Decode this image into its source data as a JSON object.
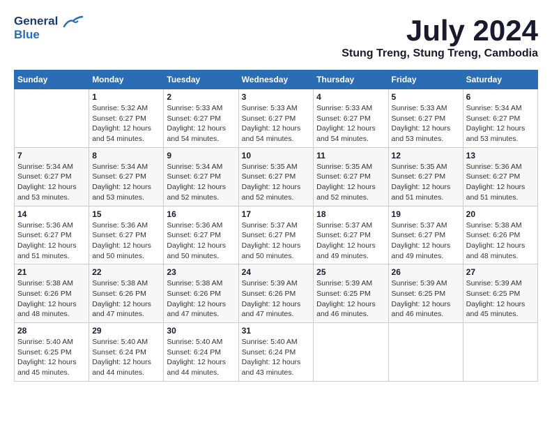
{
  "header": {
    "logo_line1": "General",
    "logo_line2": "Blue",
    "month_year": "July 2024",
    "location": "Stung Treng, Stung Treng, Cambodia"
  },
  "columns": [
    "Sunday",
    "Monday",
    "Tuesday",
    "Wednesday",
    "Thursday",
    "Friday",
    "Saturday"
  ],
  "weeks": [
    [
      {
        "day": "",
        "info": ""
      },
      {
        "day": "1",
        "info": "Sunrise: 5:32 AM\nSunset: 6:27 PM\nDaylight: 12 hours\nand 54 minutes."
      },
      {
        "day": "2",
        "info": "Sunrise: 5:33 AM\nSunset: 6:27 PM\nDaylight: 12 hours\nand 54 minutes."
      },
      {
        "day": "3",
        "info": "Sunrise: 5:33 AM\nSunset: 6:27 PM\nDaylight: 12 hours\nand 54 minutes."
      },
      {
        "day": "4",
        "info": "Sunrise: 5:33 AM\nSunset: 6:27 PM\nDaylight: 12 hours\nand 54 minutes."
      },
      {
        "day": "5",
        "info": "Sunrise: 5:33 AM\nSunset: 6:27 PM\nDaylight: 12 hours\nand 53 minutes."
      },
      {
        "day": "6",
        "info": "Sunrise: 5:34 AM\nSunset: 6:27 PM\nDaylight: 12 hours\nand 53 minutes."
      }
    ],
    [
      {
        "day": "7",
        "info": "Sunrise: 5:34 AM\nSunset: 6:27 PM\nDaylight: 12 hours\nand 53 minutes."
      },
      {
        "day": "8",
        "info": "Sunrise: 5:34 AM\nSunset: 6:27 PM\nDaylight: 12 hours\nand 53 minutes."
      },
      {
        "day": "9",
        "info": "Sunrise: 5:34 AM\nSunset: 6:27 PM\nDaylight: 12 hours\nand 52 minutes."
      },
      {
        "day": "10",
        "info": "Sunrise: 5:35 AM\nSunset: 6:27 PM\nDaylight: 12 hours\nand 52 minutes."
      },
      {
        "day": "11",
        "info": "Sunrise: 5:35 AM\nSunset: 6:27 PM\nDaylight: 12 hours\nand 52 minutes."
      },
      {
        "day": "12",
        "info": "Sunrise: 5:35 AM\nSunset: 6:27 PM\nDaylight: 12 hours\nand 51 minutes."
      },
      {
        "day": "13",
        "info": "Sunrise: 5:36 AM\nSunset: 6:27 PM\nDaylight: 12 hours\nand 51 minutes."
      }
    ],
    [
      {
        "day": "14",
        "info": "Sunrise: 5:36 AM\nSunset: 6:27 PM\nDaylight: 12 hours\nand 51 minutes."
      },
      {
        "day": "15",
        "info": "Sunrise: 5:36 AM\nSunset: 6:27 PM\nDaylight: 12 hours\nand 50 minutes."
      },
      {
        "day": "16",
        "info": "Sunrise: 5:36 AM\nSunset: 6:27 PM\nDaylight: 12 hours\nand 50 minutes."
      },
      {
        "day": "17",
        "info": "Sunrise: 5:37 AM\nSunset: 6:27 PM\nDaylight: 12 hours\nand 50 minutes."
      },
      {
        "day": "18",
        "info": "Sunrise: 5:37 AM\nSunset: 6:27 PM\nDaylight: 12 hours\nand 49 minutes."
      },
      {
        "day": "19",
        "info": "Sunrise: 5:37 AM\nSunset: 6:27 PM\nDaylight: 12 hours\nand 49 minutes."
      },
      {
        "day": "20",
        "info": "Sunrise: 5:38 AM\nSunset: 6:26 PM\nDaylight: 12 hours\nand 48 minutes."
      }
    ],
    [
      {
        "day": "21",
        "info": "Sunrise: 5:38 AM\nSunset: 6:26 PM\nDaylight: 12 hours\nand 48 minutes."
      },
      {
        "day": "22",
        "info": "Sunrise: 5:38 AM\nSunset: 6:26 PM\nDaylight: 12 hours\nand 47 minutes."
      },
      {
        "day": "23",
        "info": "Sunrise: 5:38 AM\nSunset: 6:26 PM\nDaylight: 12 hours\nand 47 minutes."
      },
      {
        "day": "24",
        "info": "Sunrise: 5:39 AM\nSunset: 6:26 PM\nDaylight: 12 hours\nand 47 minutes."
      },
      {
        "day": "25",
        "info": "Sunrise: 5:39 AM\nSunset: 6:25 PM\nDaylight: 12 hours\nand 46 minutes."
      },
      {
        "day": "26",
        "info": "Sunrise: 5:39 AM\nSunset: 6:25 PM\nDaylight: 12 hours\nand 46 minutes."
      },
      {
        "day": "27",
        "info": "Sunrise: 5:39 AM\nSunset: 6:25 PM\nDaylight: 12 hours\nand 45 minutes."
      }
    ],
    [
      {
        "day": "28",
        "info": "Sunrise: 5:40 AM\nSunset: 6:25 PM\nDaylight: 12 hours\nand 45 minutes."
      },
      {
        "day": "29",
        "info": "Sunrise: 5:40 AM\nSunset: 6:24 PM\nDaylight: 12 hours\nand 44 minutes."
      },
      {
        "day": "30",
        "info": "Sunrise: 5:40 AM\nSunset: 6:24 PM\nDaylight: 12 hours\nand 44 minutes."
      },
      {
        "day": "31",
        "info": "Sunrise: 5:40 AM\nSunset: 6:24 PM\nDaylight: 12 hours\nand 43 minutes."
      },
      {
        "day": "",
        "info": ""
      },
      {
        "day": "",
        "info": ""
      },
      {
        "day": "",
        "info": ""
      }
    ]
  ]
}
